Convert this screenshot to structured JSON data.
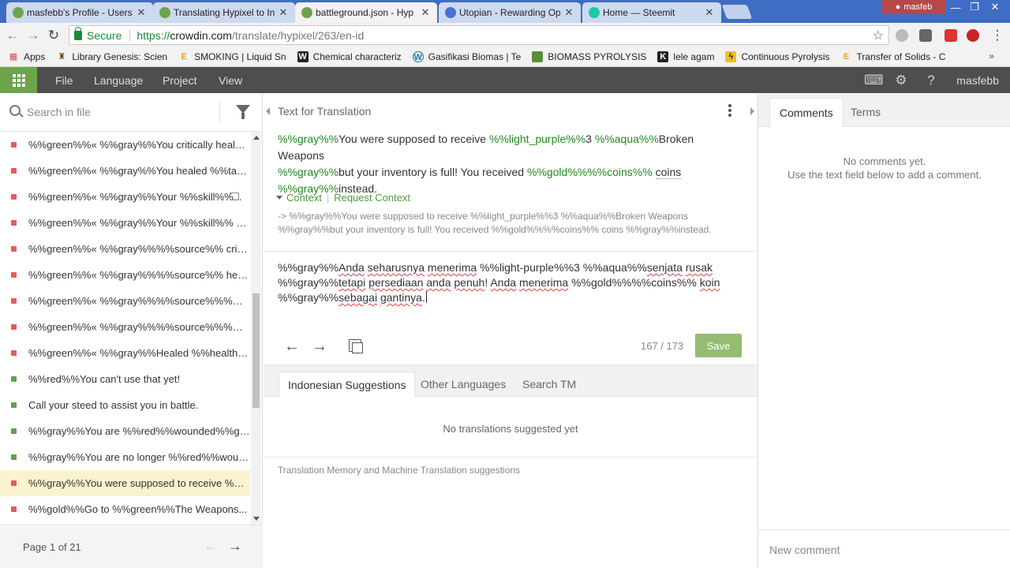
{
  "browser": {
    "tabs": [
      {
        "label": "masfebb's Profile - Users",
        "favicon_color": "#6da44b"
      },
      {
        "label": "Translating Hypixel to In",
        "favicon_color": "#6da44b"
      },
      {
        "label": "battleground.json - Hyp",
        "favicon_color": "#6da44b"
      },
      {
        "label": "Utopian - Rewarding Op",
        "favicon_color": "#4a6fd6"
      },
      {
        "label": "Home — Steemit",
        "favicon_color": "#1ec7a6"
      }
    ],
    "profile_name": "masfeb",
    "secure_label": "Secure",
    "url_proto": "https://",
    "url_host": "crowdin.com",
    "url_path": "/translate/hypixel/263/en-id",
    "bookmarks": [
      {
        "label": "Apps",
        "icon": "apps-grid-icon",
        "color": "#d44"
      },
      {
        "label": "Library Genesis: Scien",
        "icon": "book-icon",
        "color": "#6a4a2e"
      },
      {
        "label": "SMOKING | Liquid Sn",
        "icon": "letter-e-icon",
        "color": "#f0a020"
      },
      {
        "label": "Chemical characteriz",
        "icon": "letter-w-icon",
        "color": "#222"
      },
      {
        "label": "Gasifikasi Biomas | Te",
        "icon": "wordpress-icon",
        "color": "#21759b"
      },
      {
        "label": "BIOMASS PYROLYSIS",
        "icon": "doc-icon",
        "color": "#5a8f3c"
      },
      {
        "label": "lele agam",
        "icon": "letter-k-icon",
        "color": "#222"
      },
      {
        "label": "Continuous Pyrolysis",
        "icon": "lightning-icon",
        "color": "#f0c020"
      },
      {
        "label": "Transfer of Solids - C",
        "icon": "letter-e-icon",
        "color": "#f0a020"
      }
    ]
  },
  "header": {
    "menus": [
      "File",
      "Language",
      "Project",
      "View"
    ],
    "user": "masfebb"
  },
  "sidebar": {
    "search_placeholder": "Search in file",
    "items": [
      {
        "text": "%%green%%« %%gray%%You critically healed...",
        "status": "red"
      },
      {
        "text": "%%green%%« %%gray%%You healed %%targ...",
        "status": "red"
      },
      {
        "text": "%%green%%« %%gray%%Your %%skill%%...",
        "status": "red",
        "comment": true
      },
      {
        "text": "%%green%%« %%gray%%Your %%skill%% he...",
        "status": "red"
      },
      {
        "text": "%%green%%« %%gray%%%%source%% critic...",
        "status": "red"
      },
      {
        "text": "%%green%%« %%gray%%%%source%% heale...",
        "status": "red"
      },
      {
        "text": "%%green%%« %%gray%%%%source%%%%sk...",
        "status": "red"
      },
      {
        "text": "%%green%%« %%gray%%%%source%%%%sk...",
        "status": "red"
      },
      {
        "text": "%%green%%« %%gray%%Healed %%health%%",
        "status": "red"
      },
      {
        "text": "%%red%%You can't use that yet!",
        "status": "green"
      },
      {
        "text": "Call your steed to assist you in battle.",
        "status": "green"
      },
      {
        "text": "%%gray%%You are %%red%%wounded%%gr...",
        "status": "green"
      },
      {
        "text": "%%gray%%You are no longer %%red%%woun...",
        "status": "green"
      },
      {
        "text": "%%gray%%You were supposed to receive %%...",
        "status": "red",
        "selected": true
      },
      {
        "text": "%%gold%%Go to %%green%%The Weapons...",
        "status": "red"
      }
    ],
    "page_label": "Page 1 of 21"
  },
  "editor": {
    "source_header": "Text for Translation",
    "source": {
      "p1": "%%gray%%",
      "t1": "You were supposed to receive ",
      "p2": "%%light_purple%%",
      "t2": "3 ",
      "p3": "%%aqua%%",
      "t3": "Broken Weapons",
      "p4": "%%gray%%",
      "t4": "but your inventory is full! You received ",
      "p5": "%%gold%%%%coins%%",
      "t5": " ",
      "t6": "coins",
      "p6": "%%gray%%",
      "t7": "instead."
    },
    "context_label": "Context",
    "request_context_label": "Request Context",
    "context_note_line1": "-> %%gray%%You were supposed to receive %%light_purple%%3 %%aqua%%Broken Weapons",
    "context_note_line2": "%%gray%%but your inventory is full! You received %%gold%%%%coins%% coins %%gray%%instead.",
    "translation": {
      "l1a": "%%gray%%",
      "l1b": "Anda",
      "l1c": " ",
      "l1d": "seharusnya",
      "l1e": " ",
      "l1f": "menerima",
      "l1g": " %%light-purple%%3 %%aqua%%",
      "l1h": "senjata",
      "l1i": " ",
      "l1j": "rusak",
      "l2a": "%%gray%%",
      "l2b": "tetapi",
      "l2c": " ",
      "l2d": "persediaan",
      "l2e": " ",
      "l2f": "anda",
      "l2g": " ",
      "l2h": "penuh",
      "l2i": "! ",
      "l2j": "Anda",
      "l2k": " ",
      "l2l": "menerima",
      "l2m": " %%gold%%%%coins%% ",
      "l2n": "koin",
      "l3a": "%%gray%%",
      "l3b": "sebagai",
      "l3c": " ",
      "l3d": "gantinya",
      "l3e": "."
    },
    "counter": "167 / 173",
    "save_label": "Save",
    "suggestion_tabs": [
      "Indonesian Suggestions",
      "Other Languages",
      "Search TM"
    ],
    "no_suggestions": "No translations suggested yet",
    "tm_footer": "Translation Memory and Machine Translation suggestions"
  },
  "comments": {
    "tabs": [
      "Comments",
      "Terms"
    ],
    "empty_line1": "No comments yet.",
    "empty_line2": "Use the text field below to add a comment.",
    "input_placeholder": "New comment"
  }
}
